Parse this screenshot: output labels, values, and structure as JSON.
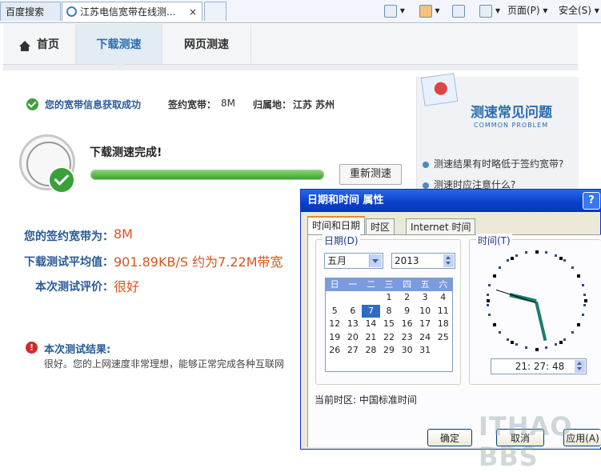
{
  "browser": {
    "tabs": [
      {
        "label": "百度搜索"
      },
      {
        "label": "江苏电信宽带在线测..."
      }
    ],
    "close_symbol": "×",
    "toolbar": {
      "home_icon": "home-icon",
      "page_label": "页面(P)",
      "safety_label": "安全(S)"
    }
  },
  "nav": {
    "home": "首页",
    "download": "下载测速",
    "web": "网页测速"
  },
  "info": {
    "status": "您的宽带信息获取成功",
    "bandwidth_label": "签约宽带：",
    "bandwidth_value": "8M",
    "location_label": "归属地：",
    "location_value": "江苏 苏州"
  },
  "test": {
    "done": "下载测速完成!",
    "progress": 1.0,
    "retest": "重新测速"
  },
  "results": {
    "signed_label": "您的签约宽带为：",
    "signed_value": "8M",
    "avg_label": "下载测试平均值：",
    "avg_value": "901.89KB/S 约为7.22M带宽",
    "eval_label": "本次测试评价：",
    "eval_value": "很好"
  },
  "summary": {
    "title": "本次测试结果:",
    "text": "很好。您的上网速度非常理想，能够正常完成各种互联网"
  },
  "faq": {
    "title": "测速常见问题",
    "subtitle": "COMMON PROBLEM",
    "items": [
      "测速结果有时略低于签约宽带?",
      "测速时应注意什么?"
    ]
  },
  "dialog": {
    "title": "日期和时间 属性",
    "help": "?",
    "tabs": [
      "时间和日期",
      "时区",
      "Internet 时间"
    ],
    "date_group": "日期(D)",
    "time_group": "时间(T)",
    "month": "五月",
    "year": "2013",
    "weekdays": [
      "日",
      "一",
      "二",
      "三",
      "四",
      "五",
      "六"
    ],
    "weeks": [
      [
        "",
        "",
        "",
        "1",
        "2",
        "3",
        "4"
      ],
      [
        "5",
        "6",
        "7",
        "8",
        "9",
        "10",
        "11"
      ],
      [
        "12",
        "13",
        "14",
        "15",
        "16",
        "17",
        "18"
      ],
      [
        "19",
        "20",
        "21",
        "22",
        "23",
        "24",
        "25"
      ],
      [
        "26",
        "27",
        "28",
        "29",
        "30",
        "31",
        ""
      ]
    ],
    "selected_day": "7",
    "time": "21: 27: 48",
    "timezone": "当前时区: 中国标准时间",
    "ok": "确定",
    "cancel": "取消",
    "apply": "应用(A)"
  },
  "watermark": "ITHAO BBS"
}
